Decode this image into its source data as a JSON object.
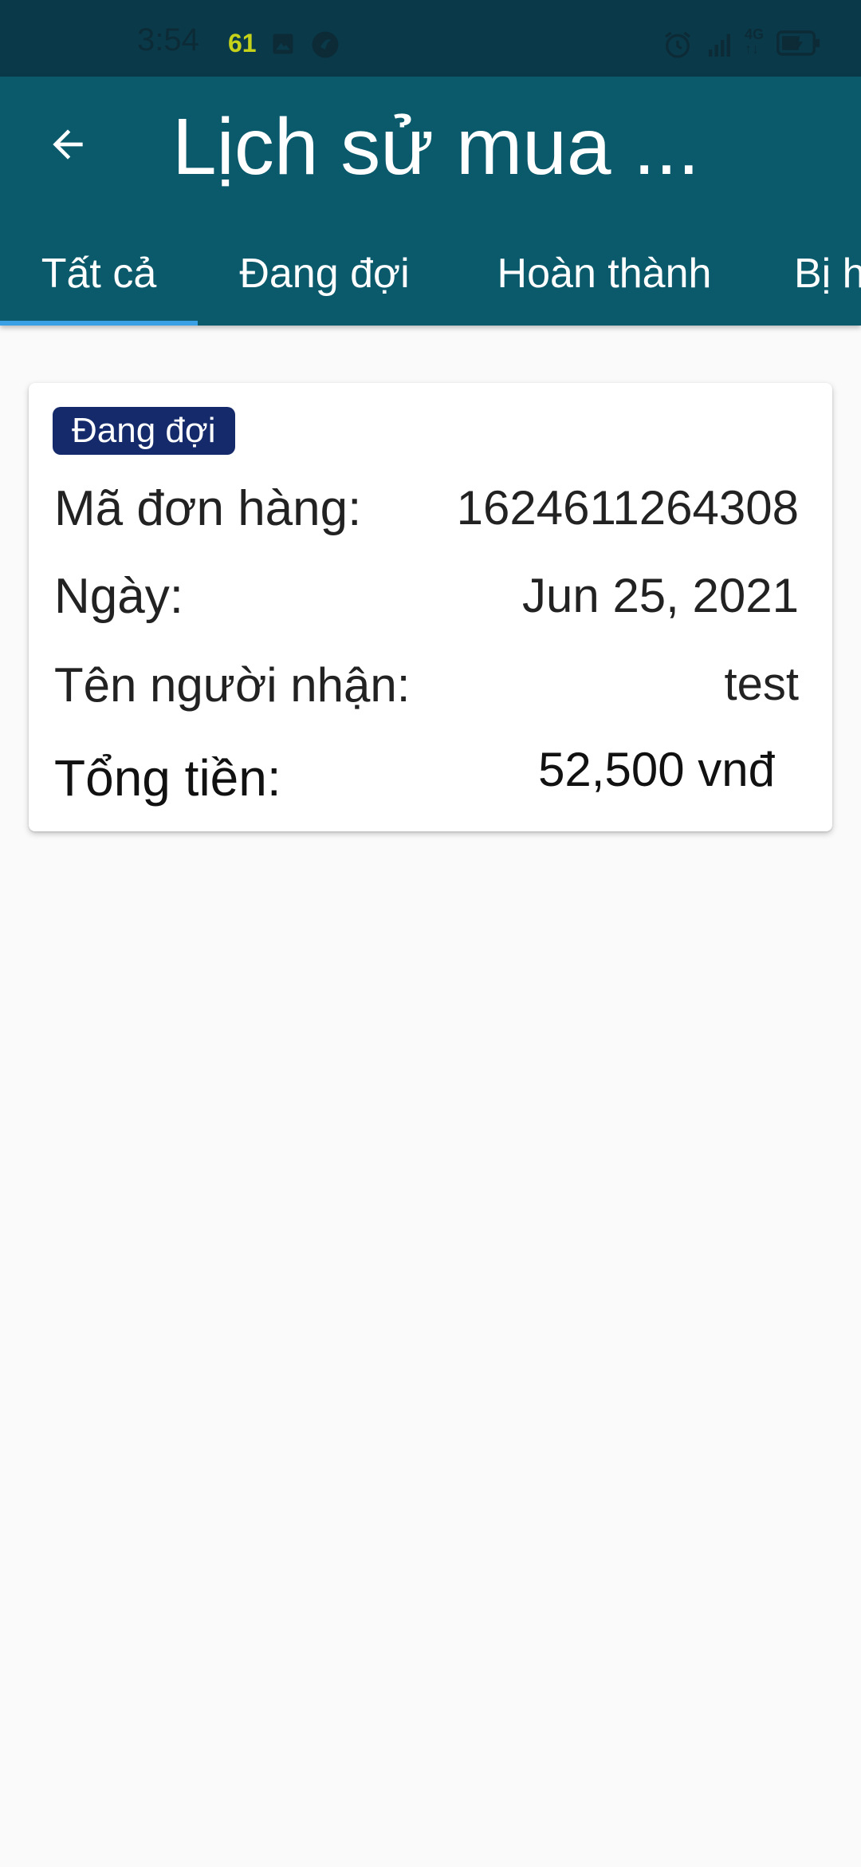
{
  "status_bar": {
    "time": "3:54",
    "notification_count": "61",
    "network_label": "4G",
    "network_arrows": "↑↓",
    "icons": [
      "gallery-icon",
      "app-icon",
      "alarm-icon",
      "signal-icon",
      "battery-icon"
    ]
  },
  "header": {
    "title": "Lịch sử mua ...",
    "back_icon": "arrow-left-icon",
    "background_color": "#0b5a6c"
  },
  "tabs": [
    {
      "label": "Tất cả",
      "selected": true
    },
    {
      "label": "Đang đợi",
      "selected": false
    },
    {
      "label": "Hoàn thành",
      "selected": false
    },
    {
      "label": "Bị h",
      "selected": false
    }
  ],
  "order": {
    "status": "Đang đợi",
    "status_color": "#142a6b",
    "fields": [
      {
        "label": "Mã đơn hàng:",
        "value": "1624611264308"
      },
      {
        "label": "Ngày:",
        "value": "Jun 25, 2021"
      },
      {
        "label": "Tên người nhận:",
        "value": "test"
      },
      {
        "label": "Tổng tiền:",
        "value": "52,500 vnđ"
      }
    ]
  },
  "colors": {
    "accent": "#3aa0e6",
    "status_bar": "#0a3a4a"
  }
}
